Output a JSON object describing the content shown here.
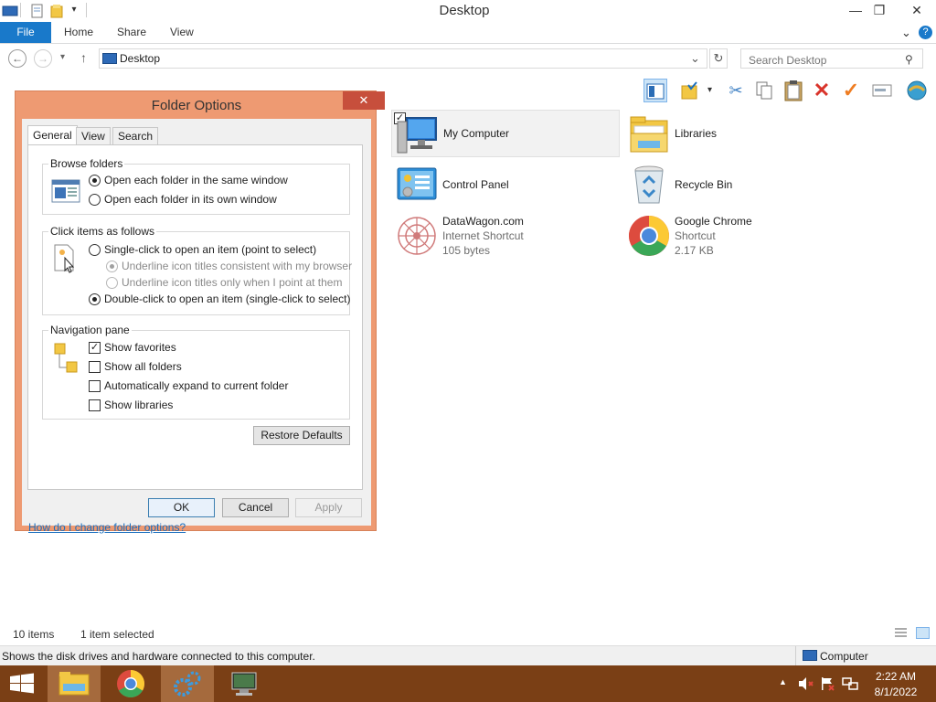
{
  "window": {
    "title": "Desktop",
    "minimize_glyph": "—",
    "restore_glyph": "❐",
    "close_glyph": "✕"
  },
  "ribbon": {
    "file": "File",
    "tabs": [
      "Home",
      "Share",
      "View"
    ],
    "expand_glyph": "⌄",
    "help_glyph": "?"
  },
  "nav": {
    "back_glyph": "←",
    "forward_glyph": "→",
    "recent_glyph": "▾",
    "up_glyph": "↑",
    "address": "Desktop",
    "address_dropdown_glyph": "⌄",
    "refresh_glyph": "↻",
    "search_placeholder": "Search Desktop",
    "search_glyph": "⚲"
  },
  "toolbar_icons": [
    "preview-pane-icon",
    "folder-check-icon",
    "cut-icon",
    "copy-icon",
    "paste-icon",
    "delete-icon",
    "checkmark-icon",
    "rename-icon",
    "globe-icon"
  ],
  "items": [
    {
      "name": "My Computer",
      "sub1": "",
      "sub2": "",
      "icon": "computer-icon",
      "selected": true
    },
    {
      "name": "Libraries",
      "sub1": "",
      "sub2": "",
      "icon": "libraries-folder-icon"
    },
    {
      "name": "Control Panel",
      "sub1": "",
      "sub2": "",
      "icon": "control-panel-icon"
    },
    {
      "name": "Recycle Bin",
      "sub1": "",
      "sub2": "",
      "icon": "recycle-bin-icon"
    },
    {
      "name": "DataWagon.com",
      "sub1": "Internet Shortcut",
      "sub2": "105 bytes",
      "icon": "datawagon-icon"
    },
    {
      "name": "Google Chrome",
      "sub1": "Shortcut",
      "sub2": "2.17 KB",
      "icon": "chrome-icon"
    }
  ],
  "status": {
    "count": "10 items",
    "selected": "1 item selected",
    "hint": "Shows the disk drives and hardware connected to this computer.",
    "location": "Computer"
  },
  "dialog": {
    "title": "Folder Options",
    "close_glyph": "✕",
    "tabs": [
      "General",
      "View",
      "Search"
    ],
    "browse": {
      "legend": "Browse folders",
      "opt1": "Open each folder in the same window",
      "opt2": "Open each folder in its own window"
    },
    "click": {
      "legend": "Click items as follows",
      "opt1": "Single-click to open an item (point to select)",
      "sub1": "Underline icon titles consistent with my browser",
      "sub2": "Underline icon titles only when I point at them",
      "opt2": "Double-click to open an item (single-click to select)"
    },
    "nav": {
      "legend": "Navigation pane",
      "opt1": "Show favorites",
      "opt2": "Show all folders",
      "opt3": "Automatically expand to current folder",
      "opt4": "Show libraries"
    },
    "restore": "Restore Defaults",
    "help": "How do I change folder options?",
    "ok": "OK",
    "cancel": "Cancel",
    "apply": "Apply",
    "check_glyph": "✓"
  },
  "tray": {
    "time": "2:22 AM",
    "date": "8/1/2022",
    "show_hidden_glyph": "▲"
  },
  "colors": {
    "file_tab": "#1979ca",
    "dialog_frame": "#ee9a72",
    "dialog_close": "#c74f3c",
    "taskbar": "#7a3f15",
    "link": "#1a6fbf"
  }
}
